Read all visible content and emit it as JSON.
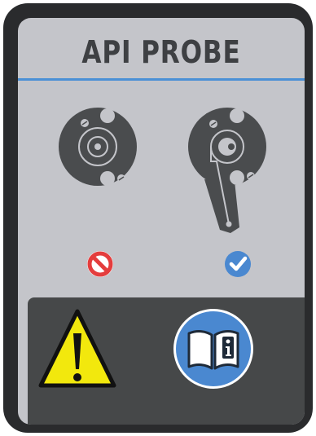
{
  "label": {
    "title": "API PROBE"
  },
  "icons": {
    "incorrect_probe": "probe-disc-icon",
    "correct_probe": "probe-with-arm-icon",
    "prohibited": "prohibited-icon",
    "approved": "checkmark-icon",
    "warning": "warning-triangle-icon",
    "manual": "read-manual-icon"
  },
  "colors": {
    "panel": "#c4c5ca",
    "border": "#2a2b2d",
    "title": "#3e4043",
    "rule": "#4a90d6",
    "probe": "#4a4c4e",
    "prohibited": "#e43d3d",
    "approved": "#4a88d0",
    "warning": "#f2e80d",
    "lower_band": "#464849"
  }
}
